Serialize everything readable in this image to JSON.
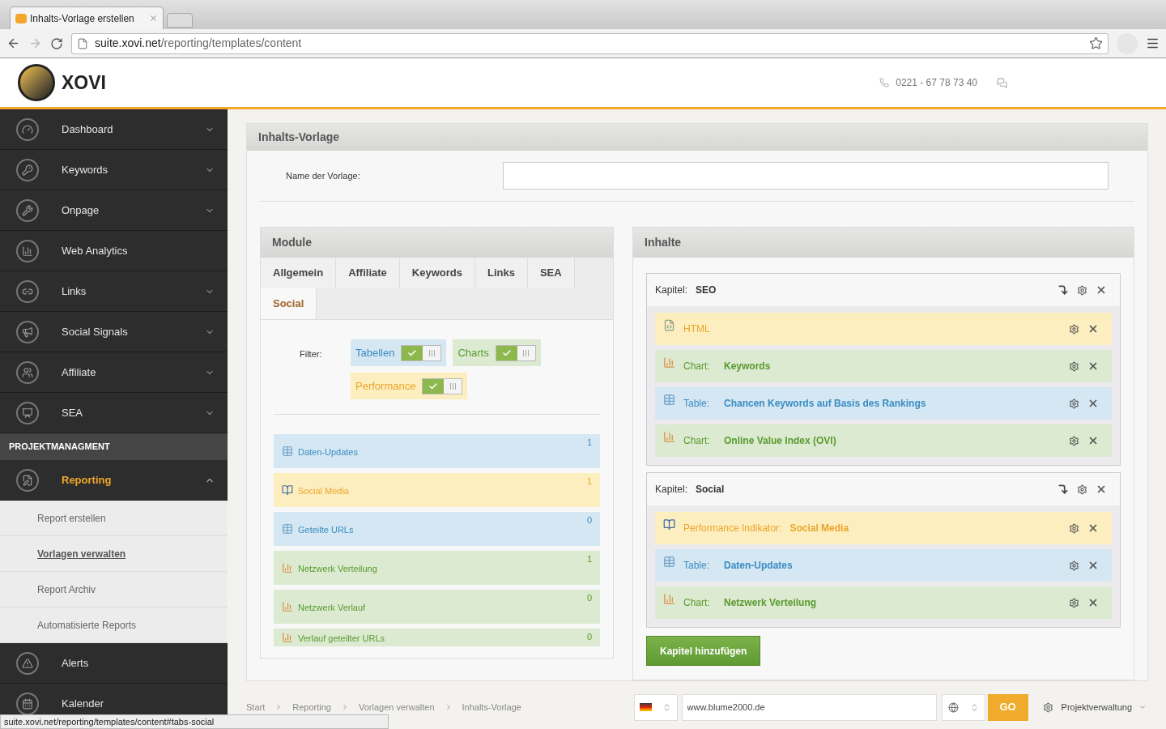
{
  "browser": {
    "tab_title": "Inhalts-Vorlage erstellen",
    "url_host": "suite.xovi.net",
    "url_path": "/reporting/templates/content",
    "status_text": "suite.xovi.net/reporting/templates/content#tabs-social"
  },
  "header": {
    "logo": "XOVI",
    "phone": "0221 - 67 78 73 40"
  },
  "sidebar": {
    "items": [
      {
        "label": "Dashboard",
        "expandable": true,
        "expanded": false,
        "selected": false
      },
      {
        "label": "Keywords",
        "expandable": true,
        "expanded": false,
        "selected": false
      },
      {
        "label": "Onpage",
        "expandable": true,
        "expanded": false,
        "selected": false
      },
      {
        "label": "Web Analytics",
        "expandable": false,
        "selected": false
      },
      {
        "label": "Links",
        "expandable": true,
        "expanded": false,
        "selected": false
      },
      {
        "label": "Social Signals",
        "expandable": true,
        "expanded": false,
        "selected": false
      },
      {
        "label": "Affiliate",
        "expandable": true,
        "expanded": false,
        "selected": false
      },
      {
        "label": "SEA",
        "expandable": true,
        "expanded": false,
        "selected": false
      }
    ],
    "section": {
      "title": "PROJEKTMANAGMENT",
      "items": [
        {
          "label": "Reporting",
          "expandable": true,
          "expanded": true,
          "selected": true,
          "children": [
            {
              "label": "Report erstellen",
              "selected": false
            },
            {
              "label": "Vorlagen verwalten",
              "selected": true
            },
            {
              "label": "Report Archiv",
              "selected": false
            },
            {
              "label": "Automatisierte Reports",
              "selected": false
            }
          ]
        },
        {
          "label": "Alerts",
          "expandable": false,
          "selected": false
        },
        {
          "label": "Kalender",
          "expandable": false,
          "selected": false
        }
      ]
    }
  },
  "panel": {
    "title": "Inhalts-Vorlage",
    "name_label": "Name der Vorlage:",
    "module": {
      "title": "Module",
      "tabs": [
        {
          "label": "Allgemein",
          "selected": false
        },
        {
          "label": "Affiliate",
          "selected": false
        },
        {
          "label": "Keywords",
          "selected": false
        },
        {
          "label": "Links",
          "selected": false
        },
        {
          "label": "SEA",
          "selected": false
        },
        {
          "label": "Social",
          "selected": true
        }
      ],
      "filter_label": "Filter:",
      "filters": [
        {
          "label": "Tabellen",
          "kind": "table",
          "on": true
        },
        {
          "label": "Charts",
          "kind": "chart",
          "on": true
        },
        {
          "label": "Performance",
          "kind": "performance",
          "on": true
        }
      ],
      "items": [
        {
          "label": "Daten-Updates",
          "kind": "table",
          "count": "1"
        },
        {
          "label": "Social Media",
          "kind": "performance",
          "count": "1"
        },
        {
          "label": "Geteilte URLs",
          "kind": "table",
          "count": "0"
        },
        {
          "label": "Netzwerk Verteilung",
          "kind": "chart",
          "count": "1"
        },
        {
          "label": "Netzwerk Verlauf",
          "kind": "chart",
          "count": "0"
        },
        {
          "label": "Verlauf geteilter URLs",
          "kind": "chart",
          "count": "0"
        }
      ]
    },
    "contents": {
      "title": "Inhalte",
      "chapters": [
        {
          "label": "Kapitel:",
          "name": "SEO",
          "items": [
            {
              "kind": "html",
              "type_label": "HTML"
            },
            {
              "kind": "chart",
              "type_label": "Chart:",
              "name": "Keywords"
            },
            {
              "kind": "table",
              "type_label": "Table:",
              "name": "Chancen Keywords auf Basis des Rankings"
            },
            {
              "kind": "chart",
              "type_label": "Chart:",
              "name": "Online Value Index (OVI)"
            }
          ]
        },
        {
          "label": "Kapitel:",
          "name": "Social",
          "items": [
            {
              "kind": "performance",
              "type_label": "Performance Indikator:",
              "name": "Social Media"
            },
            {
              "kind": "table",
              "type_label": "Table:",
              "name": "Daten-Updates"
            },
            {
              "kind": "chart",
              "type_label": "Chart:",
              "name": "Netzwerk Verteilung"
            }
          ]
        }
      ],
      "add_button": "Kapitel hinzufügen"
    }
  },
  "footer": {
    "breadcrumbs": [
      "Start",
      "Reporting",
      "Vorlagen verwalten",
      "Inhalts-Vorlage"
    ],
    "domain": "www.blume2000.de",
    "go": "GO",
    "project_menu": "Projektverwaltung"
  }
}
